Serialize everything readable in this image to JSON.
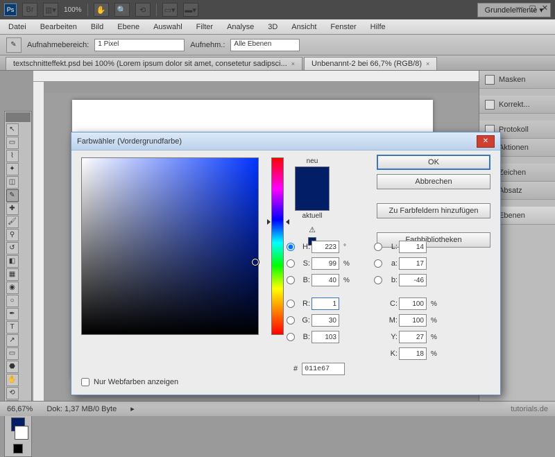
{
  "appbar": {
    "zoom": "100%",
    "workspace": "Grundelemente ▾"
  },
  "menu": [
    "Datei",
    "Bearbeiten",
    "Bild",
    "Ebene",
    "Auswahl",
    "Filter",
    "Analyse",
    "3D",
    "Ansicht",
    "Fenster",
    "Hilfe"
  ],
  "optbar": {
    "label1": "Aufnahmebereich:",
    "sel1": "1 Pixel",
    "label2": "Aufnehm.:",
    "sel2": "Alle Ebenen"
  },
  "tabs": [
    {
      "label": "textschnitteffekt.psd bei 100% (Lorem ipsum dolor sit amet, consetetur sadipsci...",
      "active": false
    },
    {
      "label": "Unbenannt-2 bei 66,7% (RGB/8)",
      "active": true
    }
  ],
  "rightPanels": [
    "Masken",
    "Korrekt...",
    "Protokoll",
    "Aktionen",
    "Zeichen",
    "Absatz",
    "Ebenen"
  ],
  "status": {
    "zoom": "66,67%",
    "doc": "Dok: 1,37 MB/0 Byte",
    "brand": "tutorials.de"
  },
  "dialog": {
    "title": "Farbwähler (Vordergrundfarbe)",
    "neu": "neu",
    "aktuell": "aktuell",
    "buttons": {
      "ok": "OK",
      "cancel": "Abbrechen",
      "add": "Zu Farbfeldern hinzufügen",
      "lib": "Farbbibliotheken"
    },
    "hsb": {
      "H": "223",
      "S": "99",
      "B": "40"
    },
    "rgb": {
      "R": "1",
      "G": "30",
      "B": "103"
    },
    "lab": {
      "L": "14",
      "a": "17",
      "b": "-46"
    },
    "cmyk": {
      "C": "100",
      "M": "100",
      "Y": "27",
      "K": "18"
    },
    "hex": "011e67",
    "webonly": "Nur Webfarben anzeigen",
    "units": {
      "deg": "°",
      "pct": "%"
    }
  },
  "colors": {
    "fg": "#011e67"
  }
}
